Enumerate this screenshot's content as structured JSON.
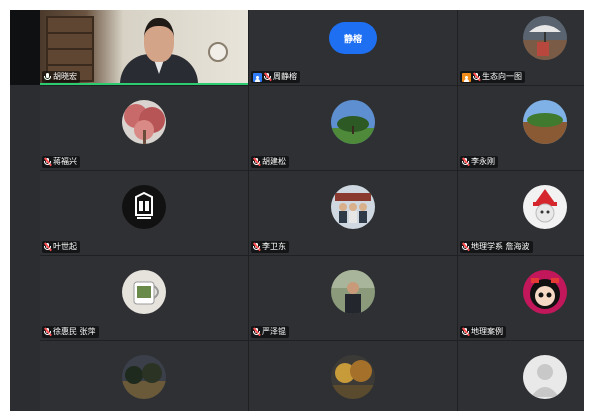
{
  "meeting": {
    "participants": [
      {
        "name": "胡晓宏",
        "muted": false,
        "speaking": true,
        "video": true,
        "role": "",
        "avatar": "video"
      },
      {
        "name": "周静榕",
        "muted": true,
        "speaking": false,
        "video": false,
        "role": "host",
        "avatar": "initials",
        "initials": "静榕"
      },
      {
        "name": "生态向一图",
        "muted": true,
        "speaking": false,
        "video": false,
        "role": "cohost",
        "avatar": "photo-umbrella"
      },
      {
        "name": "蒋福兴",
        "muted": true,
        "speaking": false,
        "video": false,
        "role": "",
        "avatar": "photo-blossom"
      },
      {
        "name": "胡建松",
        "muted": true,
        "speaking": false,
        "video": false,
        "role": "",
        "avatar": "photo-tree"
      },
      {
        "name": "李永刚",
        "muted": true,
        "speaking": false,
        "video": false,
        "role": "",
        "avatar": "photo-field"
      },
      {
        "name": "叶世起",
        "muted": true,
        "speaking": false,
        "video": false,
        "role": "",
        "avatar": "logo-shield"
      },
      {
        "name": "李卫东",
        "muted": true,
        "speaking": false,
        "video": false,
        "role": "",
        "avatar": "photo-group"
      },
      {
        "name": "地理学系 詹海波",
        "muted": true,
        "speaking": false,
        "video": false,
        "role": "",
        "avatar": "photo-red-hat"
      },
      {
        "name": "徐惠民 张萍",
        "muted": true,
        "speaking": false,
        "video": false,
        "role": "",
        "avatar": "photo-mug"
      },
      {
        "name": "严泽锟",
        "muted": true,
        "speaking": false,
        "video": false,
        "role": "",
        "avatar": "photo-man"
      },
      {
        "name": "地理案例",
        "muted": true,
        "speaking": false,
        "video": false,
        "role": "",
        "avatar": "photo-doll"
      },
      {
        "name": "",
        "muted": true,
        "speaking": false,
        "video": false,
        "role": "",
        "avatar": "photo-dark-trees"
      },
      {
        "name": "",
        "muted": true,
        "speaking": false,
        "video": false,
        "role": "",
        "avatar": "photo-autumn"
      },
      {
        "name": "",
        "muted": true,
        "speaking": false,
        "video": false,
        "role": "",
        "avatar": "default-silhouette"
      }
    ]
  },
  "colors": {
    "host_badge": "#2f7cf6",
    "cohost_badge": "#f08c19",
    "speaking_border": "#2ecc71",
    "initials_avatar": "#1f6ff2",
    "muted_slash": "#ff4d4f"
  }
}
